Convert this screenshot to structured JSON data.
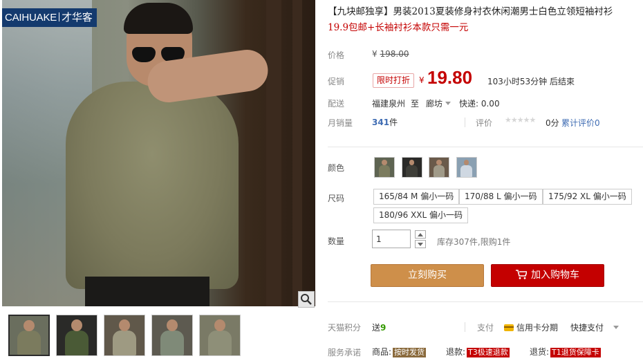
{
  "gallery": {
    "brand_name": "CAIHUAKE",
    "brand_cn": "才华客",
    "thumbnails": [
      {
        "colors": [
          "#6a6e5e",
          "#7b7b5e"
        ],
        "active": true
      },
      {
        "colors": [
          "#2a2a28",
          "#4a5a36"
        ],
        "active": false
      },
      {
        "colors": [
          "#60584a",
          "#9e9a82"
        ],
        "active": false
      },
      {
        "colors": [
          "#5d5a50",
          "#7f8a78"
        ],
        "active": false
      },
      {
        "colors": [
          "#7a7a66",
          "#8e8f78"
        ],
        "active": false
      }
    ]
  },
  "product": {
    "title_main": "【九块邮独享】男装2013夏装修身衬衣休闲潮男士白色立领短袖衬衫",
    "title_sub": "19.9包邮+长袖衬衫本款只需一元"
  },
  "price": {
    "label": "价格",
    "currency": "¥",
    "original": "198.00"
  },
  "promo": {
    "label": "促销",
    "tag": "限时打折",
    "currency": "¥",
    "value": "19.80",
    "countdown": "103小时53分钟 后结束"
  },
  "delivery": {
    "label": "配送",
    "from": "福建泉州",
    "to_word": "至",
    "to": "廊坊",
    "shipping": "快递: 0.00"
  },
  "sales": {
    "label": "月销量",
    "count": "341",
    "unit": "件",
    "rating_label": "评价",
    "stars": "★★★★★",
    "score": "0分",
    "total_reviews": "累计评价0"
  },
  "color": {
    "label": "颜色",
    "swatches": [
      {
        "colors": [
          "#5e6452",
          "#7b7b5e"
        ]
      },
      {
        "colors": [
          "#2a2a28",
          "#3e3e38"
        ]
      },
      {
        "colors": [
          "#6a5a4a",
          "#a09a88"
        ]
      },
      {
        "colors": [
          "#8aa0b2",
          "#cfd8e2"
        ]
      }
    ]
  },
  "size": {
    "label": "尺码",
    "options": [
      "165/84 M 偏小一码",
      "170/88 L 偏小一码",
      "175/92 XL 偏小一码",
      "180/96 XXL 偏小一码"
    ]
  },
  "quantity": {
    "label": "数量",
    "value": "1",
    "stock": "库存307件,限购1件"
  },
  "buttons": {
    "buy_now": "立刻购买",
    "add_to_cart": "加入购物车"
  },
  "points": {
    "label": "天猫积分",
    "prefix": "送",
    "value": "9",
    "pay_label": "支付",
    "credit_installment": "信用卡分期",
    "quick_pay": "快捷支付"
  },
  "service": {
    "label": "服务承诺",
    "goods_label": "商品:",
    "goods_badge": "按时发货",
    "refund_label": "退款:",
    "refund_badge": "T3极速退款",
    "return_label": "退货:",
    "return_badge": "T1退货保障卡"
  },
  "icons": {
    "zoom": "magnifier-icon",
    "cart": "shopping-cart-icon",
    "card": "credit-card-icon"
  },
  "colors": {
    "accent_red": "#c40000",
    "buy_orange": "#ce8f4a",
    "brand_blue": "#143a6e"
  }
}
